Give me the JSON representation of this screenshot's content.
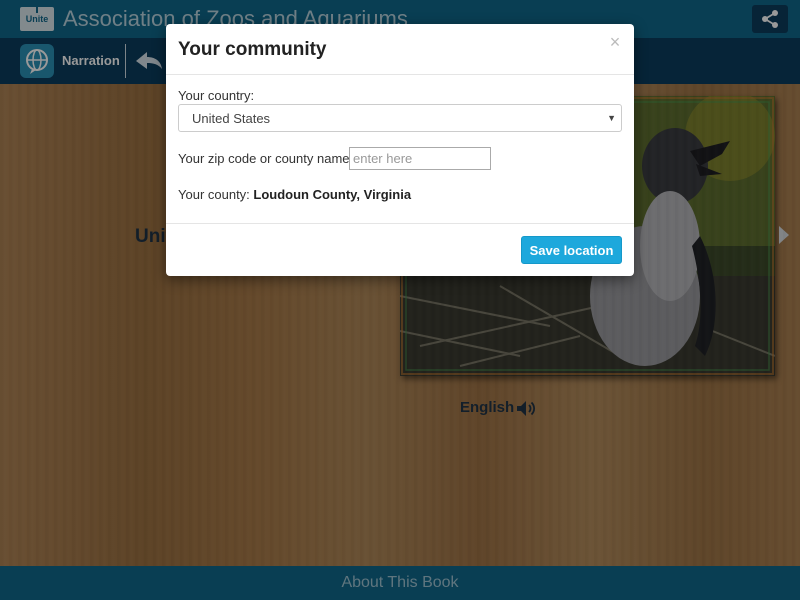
{
  "header": {
    "logo_text": "Unite",
    "title": "Association of Zoos and Aquariums",
    "share_icon": "share-icon"
  },
  "toolbar": {
    "narration_icon": "globe-speech-icon",
    "narration_label": "Narration",
    "back_icon": "back-arrow-icon"
  },
  "page": {
    "heading_visible": "Unit",
    "photo": "penguin-chick-photo",
    "language_label": "English",
    "speaker_icon": "speaker-icon",
    "next_icon": "chevron-right-icon"
  },
  "footer": {
    "label": "About This Book"
  },
  "modal": {
    "title": "Your community",
    "close_symbol": "×",
    "country_label": "Your country:",
    "country_value": "United States",
    "zip_label": "Your zip code or county name:",
    "zip_value": "",
    "zip_placeholder": "enter here",
    "county_label": "Your county: ",
    "county_value": "Loudoun County, Virginia",
    "save_label": "Save location"
  },
  "colors": {
    "header_bg": "#10688a",
    "toolbar_bg": "#0b3c5e",
    "save_button": "#1da8dc"
  }
}
